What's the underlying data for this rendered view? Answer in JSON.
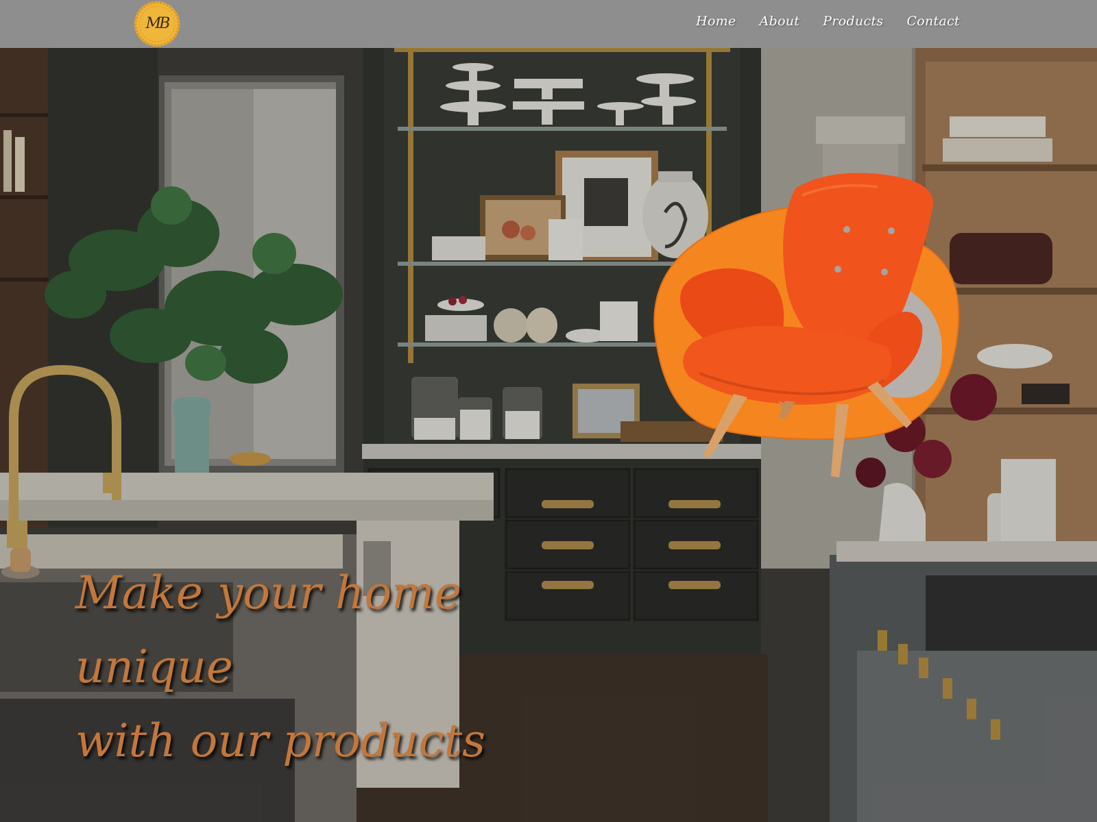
{
  "header": {
    "logo_text": "MB",
    "nav": [
      "Home",
      "About",
      "Products",
      "Contact"
    ]
  },
  "hero": {
    "headline_line1": "Make your home unique",
    "headline_line2": "with our products"
  },
  "colors": {
    "header_bg": "#8e8e8e",
    "logo": "#f0b63a",
    "accent": "#c3773a",
    "blob": "#f5851f",
    "chair": "#f0531c"
  }
}
